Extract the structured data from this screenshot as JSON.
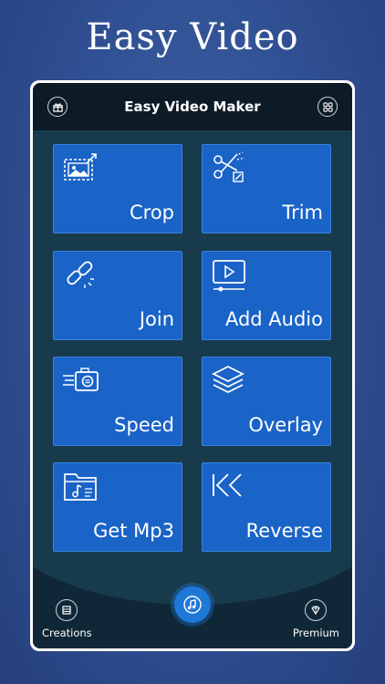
{
  "headline": "Easy Video",
  "app": {
    "title": "Easy Video Maker"
  },
  "tiles": [
    {
      "label": "Crop",
      "icon": "crop-icon"
    },
    {
      "label": "Trim",
      "icon": "scissors-icon"
    },
    {
      "label": "Join",
      "icon": "link-icon"
    },
    {
      "label": "Add Audio",
      "icon": "video-play-icon"
    },
    {
      "label": "Speed",
      "icon": "speed-camera-icon"
    },
    {
      "label": "Overlay",
      "icon": "layers-icon"
    },
    {
      "label": "Get Mp3",
      "icon": "music-folder-icon"
    },
    {
      "label": "Reverse",
      "icon": "rewind-icon"
    }
  ],
  "bottom": {
    "creations": "Creations",
    "premium": "Premium"
  },
  "colors": {
    "tile": "#1a63c7",
    "accent": "#1f78d8",
    "background": "#2f4f92"
  }
}
